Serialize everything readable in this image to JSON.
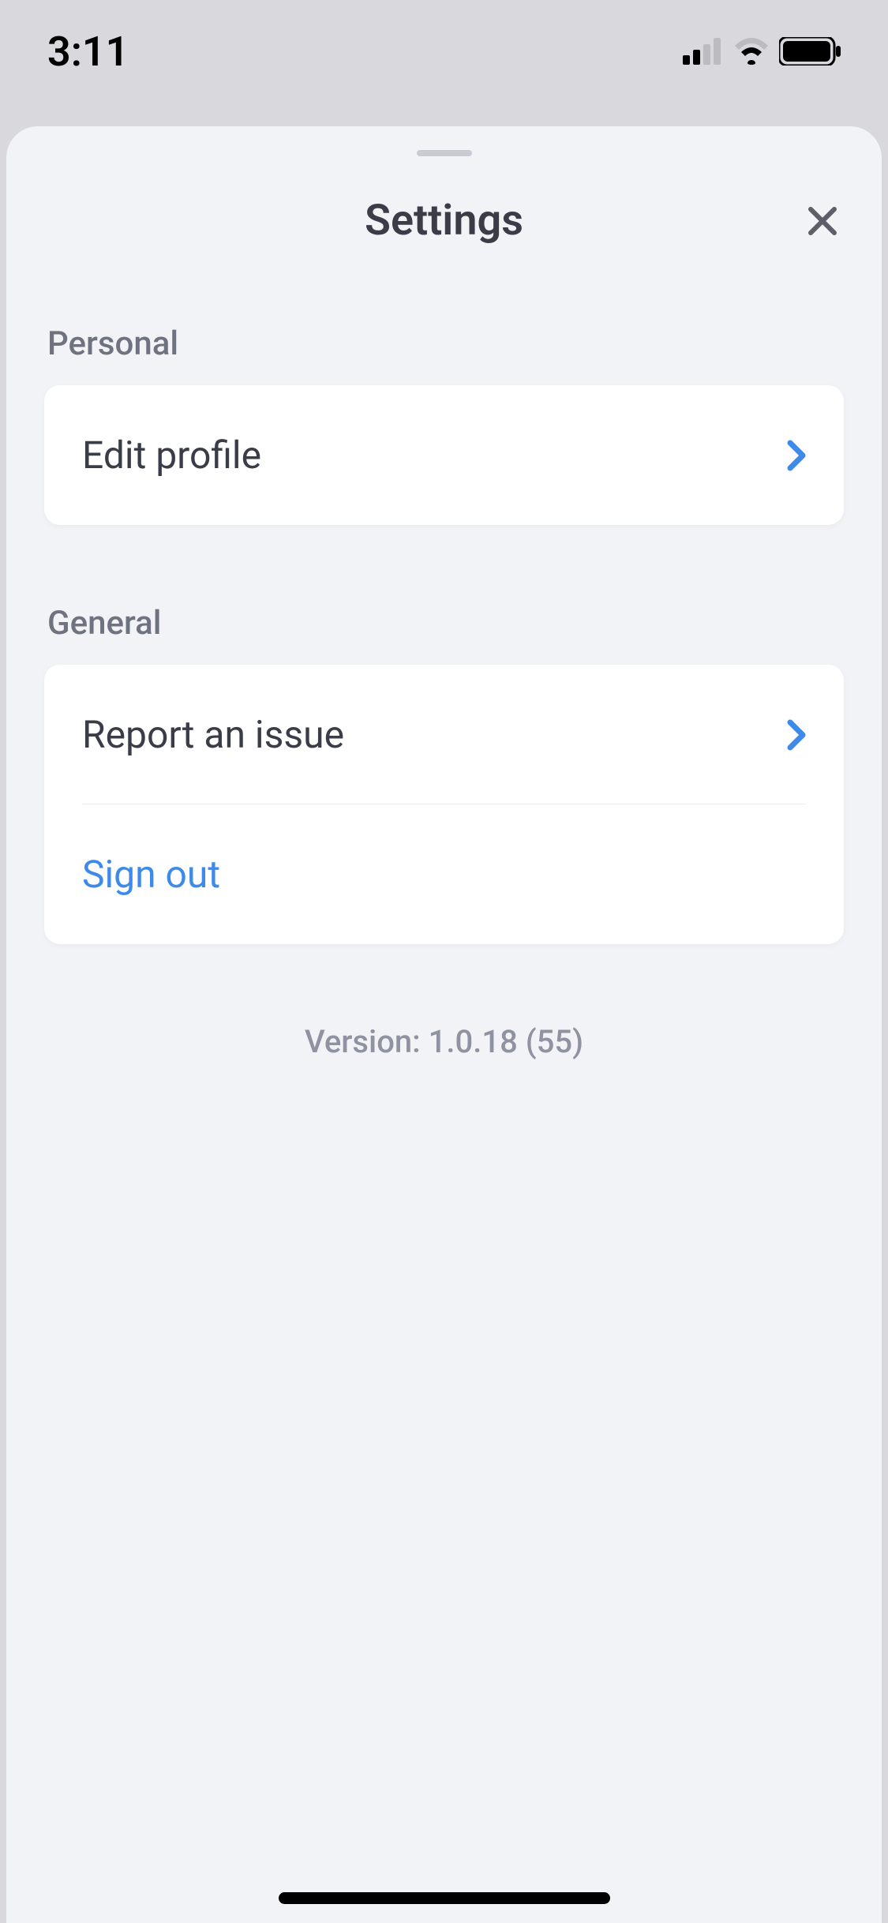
{
  "statusBar": {
    "time": "3:11"
  },
  "sheet": {
    "title": "Settings"
  },
  "sections": {
    "personal": {
      "header": "Personal",
      "editProfile": "Edit profile"
    },
    "general": {
      "header": "General",
      "reportIssue": "Report an issue",
      "signOut": "Sign out"
    }
  },
  "version": "Version: 1.0.18 (55)"
}
